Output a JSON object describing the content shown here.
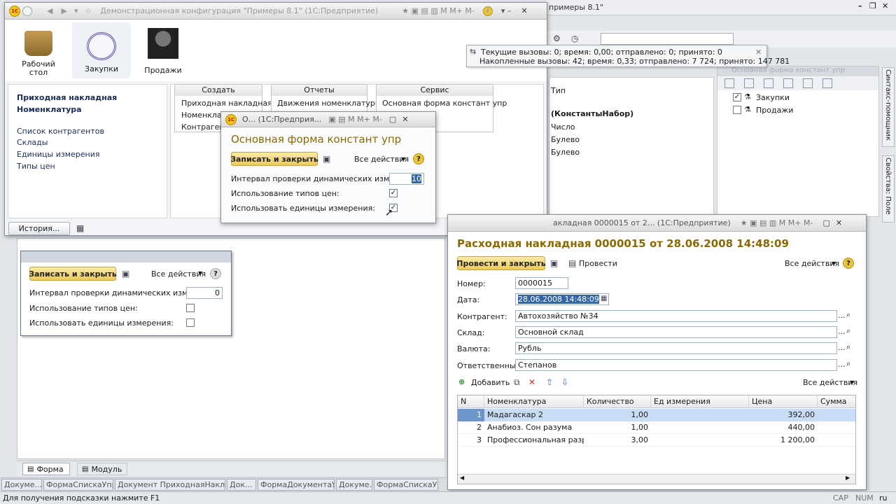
{
  "main_window": {
    "title": "Демонстрационная конфигурация \"Примеры 8.1\"   (1С:Предприятие)",
    "sections": [
      {
        "label": "Рабочий стол"
      },
      {
        "label": "Закупки"
      },
      {
        "label": "Продажи"
      }
    ],
    "nav_links_bold": [
      "Приходная накладная",
      "Номенклатура"
    ],
    "nav_links": [
      "Список контрагентов",
      "Склады",
      "Единицы измерения",
      "Типы цен"
    ],
    "panels": [
      {
        "title": "Создать",
        "items": [
          "Приходная накладная",
          "Номенклатура",
          "Контрагент"
        ]
      },
      {
        "title": "Отчеты",
        "items": [
          "Движения номенклатуры"
        ]
      },
      {
        "title": "Сервис",
        "items": [
          "Основная форма констант упр"
        ]
      }
    ],
    "history_button": "История..."
  },
  "designer_title": "примеры 8.1\"",
  "notification": {
    "line1": "Текущие вызовы: 0; время: 0,00; отправлено: 0; принято: 0",
    "line2": "Накопленные вызовы: 42; время: 0,33; отправлено: 7 724; принято: 147 781"
  },
  "designer_props": {
    "type_header": "Тип",
    "types": [
      "(КонстантыНабор)",
      "Число",
      "Булево",
      "Булево"
    ],
    "right_panel_title": "Основная форма констант упр",
    "tree_items": [
      {
        "label": "Закупки",
        "checked": true
      },
      {
        "label": "Продажи",
        "checked": false
      }
    ],
    "side_tabs": [
      "Синтакс-помощник",
      "Свойства: Поле"
    ]
  },
  "constants_window": {
    "title": "О...  (1С:Предприя...",
    "heading": "Основная форма констант упр",
    "save_close": "Записать и закрыть",
    "all_actions": "Все действия",
    "fields": [
      {
        "label": "Интервал проверки динамических изменений:",
        "value": "10"
      },
      {
        "label": "Использование типов цен:",
        "checked": true
      },
      {
        "label": "Использовать единицы измерения:",
        "checked": true
      }
    ]
  },
  "form_preview": {
    "save_close": "Записать и закрыть",
    "all_actions": "Все действия",
    "fields": [
      {
        "label": "Интервал проверки динамических изменений:",
        "value": "0"
      },
      {
        "label": "Использование типов цен:",
        "checked": false
      },
      {
        "label": "Использовать единицы измерения:",
        "checked": false
      }
    ],
    "tabs": [
      "Форма",
      "Модуль"
    ]
  },
  "invoice_window": {
    "title": "акладная 0000015 от 2...  (1С:Предприятие)",
    "heading": "Расходная накладная 0000015 от 28.06.2008 14:48:09",
    "post_close": "Провести и закрыть",
    "post": "Провести",
    "all_actions": "Все действия",
    "fields": {
      "number_label": "Номер:",
      "number": "0000015",
      "date_label": "Дата:",
      "date": "28.06.2008 14:48:09",
      "contractor_label": "Контрагент:",
      "contractor": "Автохозяйство №34",
      "warehouse_label": "Склад:",
      "warehouse": "Основной склад",
      "currency_label": "Валюта:",
      "currency": "Рубль",
      "responsible_label": "Ответственный:",
      "responsible": "Степанов"
    },
    "add_label": "Добавить",
    "table_actions": "Все действия",
    "columns": [
      "N",
      "Номенклатура",
      "Количество",
      "Ед измерения",
      "Цена",
      "Сумма"
    ],
    "rows": [
      {
        "n": "1",
        "item": "Мадагаскар 2",
        "qty": "1,00",
        "unit": "",
        "price": "392,00",
        "sum": ""
      },
      {
        "n": "2",
        "item": "Анабиоз. Сон разума",
        "qty": "1,00",
        "unit": "",
        "price": "440,00",
        "sum": ""
      },
      {
        "n": "3",
        "item": "Профессиональная разр...",
        "qty": "3,00",
        "unit": "",
        "price": "1 200,00",
        "sum": ""
      }
    ]
  },
  "taskbar": [
    "Докуме...",
    "ФормаСпискаУпр",
    "Документ ПриходнаяНакла...",
    "Док...",
    "ФормаДокументаУпр",
    "Докуме...",
    "ФормаСпискаУпр"
  ],
  "status": {
    "hint": "Для получения подсказки нажмите F1",
    "cap": "CAP",
    "num": "NUM",
    "lang": "ru"
  },
  "colors": {
    "accent_gold": "#8a6a00",
    "selection": "#c8dcf5",
    "link": "#1a2d55"
  }
}
